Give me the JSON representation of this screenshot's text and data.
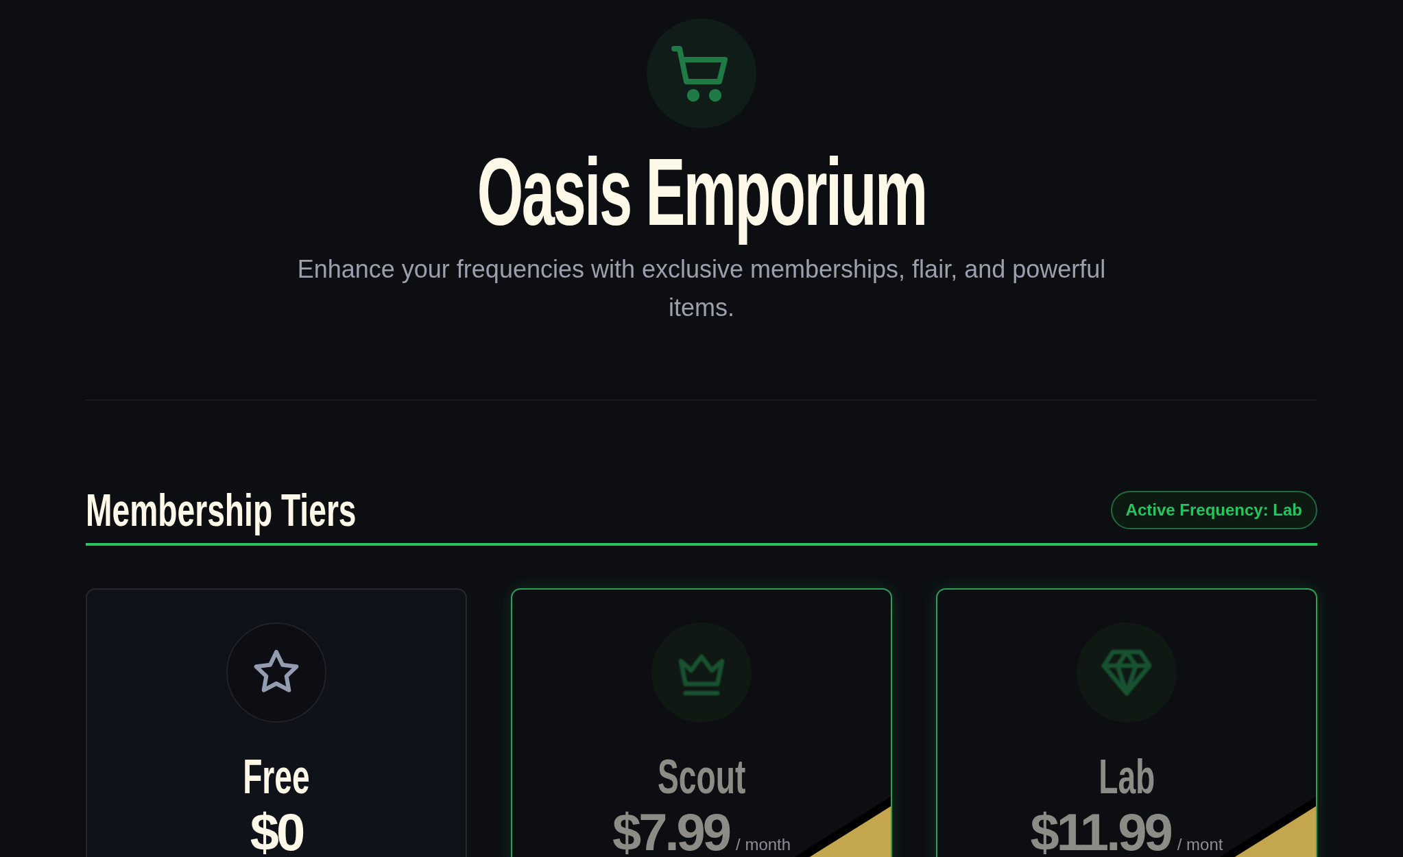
{
  "header": {
    "title": "Oasis Emporium",
    "subtitle": "Enhance your frequencies with exclusive memberships, flair, and powerful items."
  },
  "section": {
    "title": "Membership Tiers",
    "badge": "Active Frequency: Lab"
  },
  "tiers": [
    {
      "name": "Free",
      "price": "$0",
      "kind": "star",
      "locked": false
    },
    {
      "name": "Scout",
      "price": "$7.99",
      "period": "/ month",
      "kind": "crown",
      "locked": true
    },
    {
      "name": "Lab",
      "price": "$11.99",
      "period": "/ mont",
      "kind": "gem",
      "locked": true
    }
  ]
}
